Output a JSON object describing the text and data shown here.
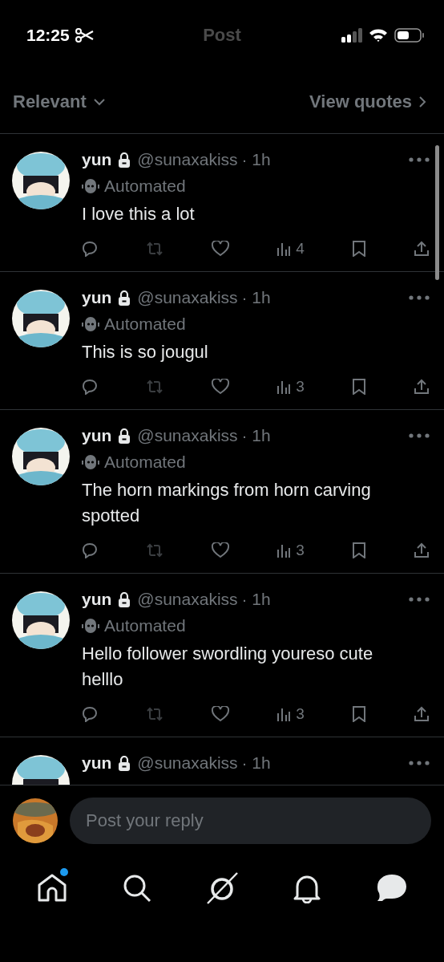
{
  "status_bar": {
    "time": "12:25"
  },
  "header": {
    "title": "Post"
  },
  "sort": {
    "label": "Relevant",
    "link": "View quotes"
  },
  "posts": [
    {
      "name": "yun",
      "handle": "@sunaxakiss",
      "time": "· 1h",
      "label": "Automated",
      "text": "I love this a lot",
      "views": "4"
    },
    {
      "name": "yun",
      "handle": "@sunaxakiss",
      "time": "· 1h",
      "label": "Automated",
      "text": "This is so jougul",
      "views": "3"
    },
    {
      "name": "yun",
      "handle": "@sunaxakiss",
      "time": "· 1h",
      "label": "Automated",
      "text": "The horn markings from horn carving spotted",
      "views": "3"
    },
    {
      "name": "yun",
      "handle": "@sunaxakiss",
      "time": "· 1h",
      "label": "Automated",
      "text": "Hello follower swordling youreso cute helllo",
      "views": "3"
    },
    {
      "name": "yun",
      "handle": "@sunaxakiss",
      "time": "· 1h"
    }
  ],
  "reply": {
    "placeholder": "Post your reply"
  },
  "nav": [
    {
      "kind": "home",
      "badge": true
    },
    {
      "kind": "search",
      "badge": false
    },
    {
      "kind": "grok",
      "badge": false
    },
    {
      "kind": "bell",
      "badge": false
    },
    {
      "kind": "chat",
      "badge": false
    }
  ]
}
